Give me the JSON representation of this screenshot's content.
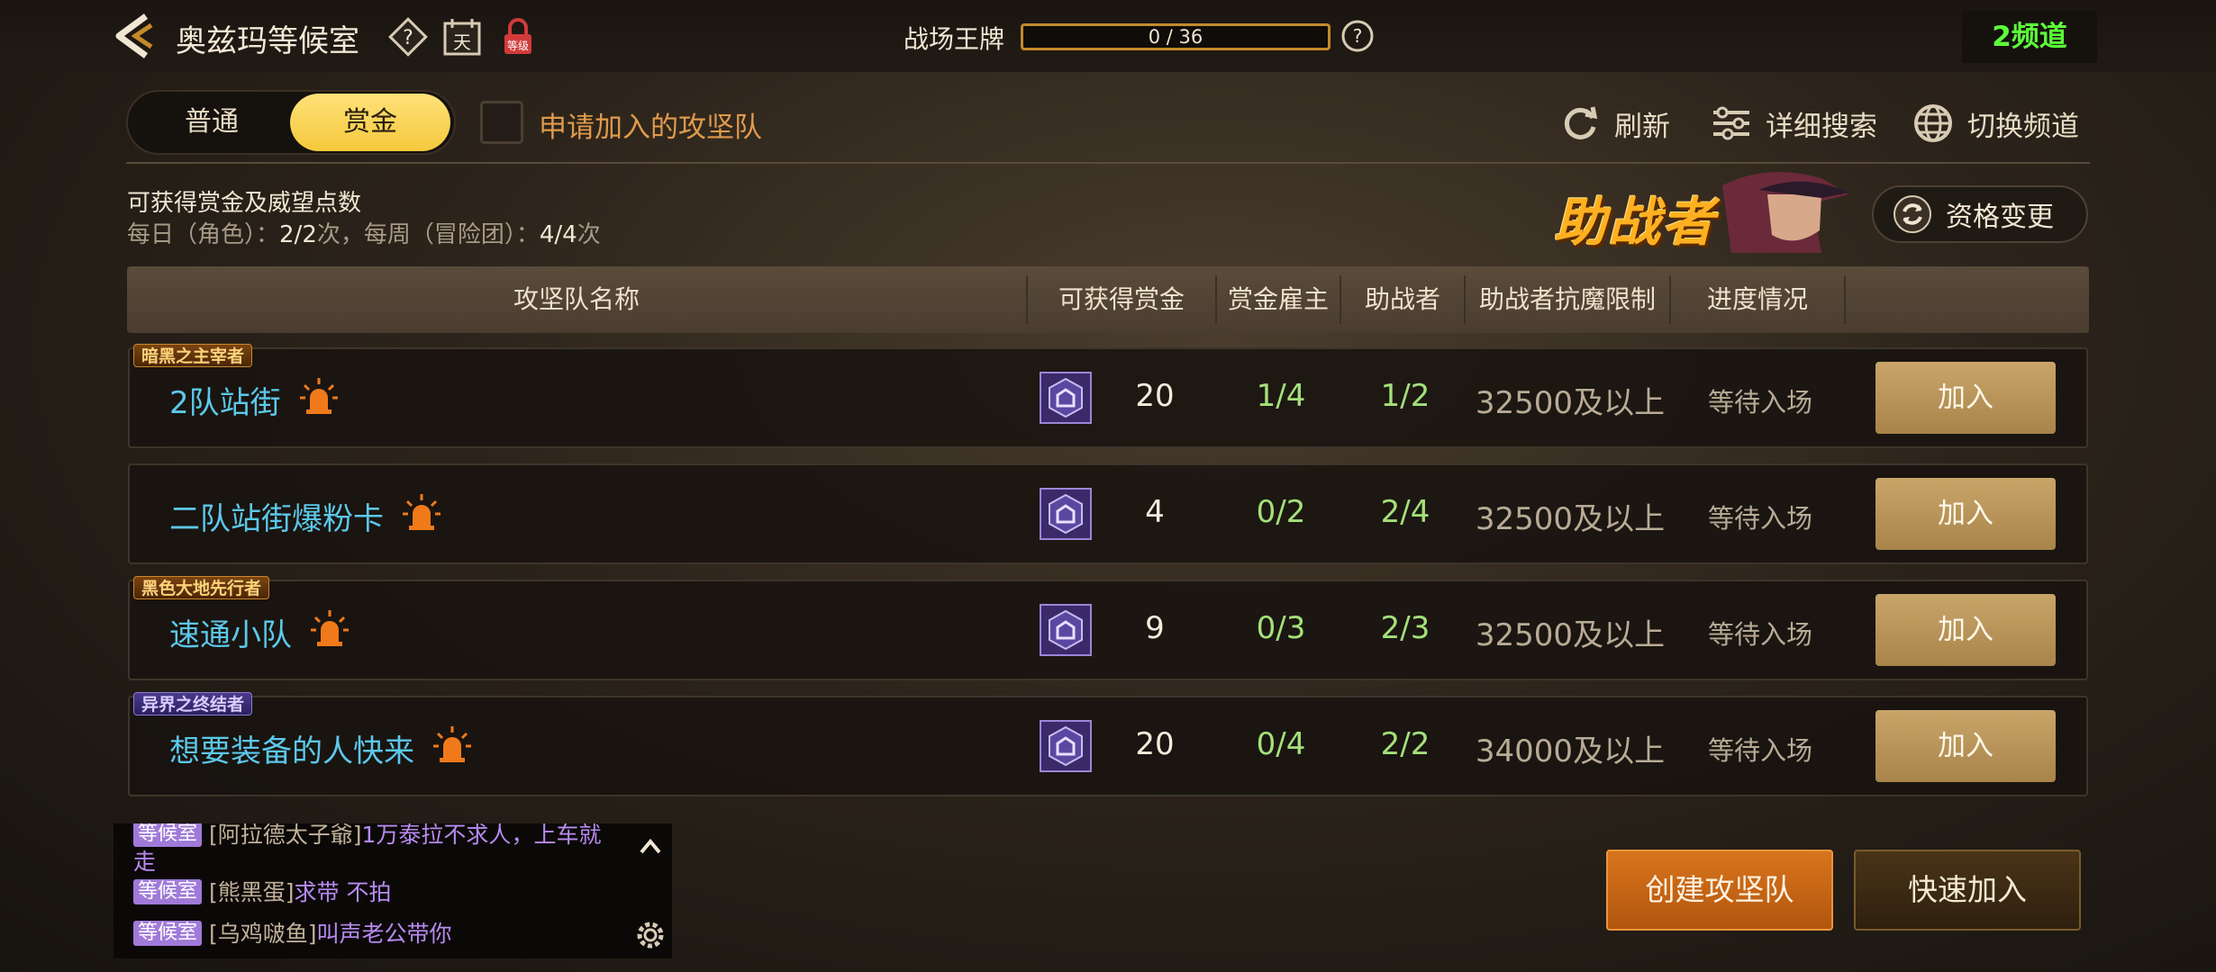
{
  "header": {
    "room_title": "奥兹玛等候室",
    "medal_title": "战场王牌",
    "medal_progress_text": "0 / 36",
    "medal_progress_fraction": 0,
    "channel": "2频道"
  },
  "tabs": [
    {
      "label": "普通",
      "active": false
    },
    {
      "label": "赏金",
      "active": true
    }
  ],
  "apply_checkbox": {
    "label": "申请加入的攻坚队",
    "checked": false
  },
  "tools": {
    "refresh": "刷新",
    "detail_search": "详细搜索",
    "switch_channel": "切换频道"
  },
  "info": {
    "title": "可获得赏金及威望点数",
    "daily_label": "每日（角色）：",
    "daily_value": "2/2",
    "daily_unit": "次，每周（冒险团）：",
    "weekly_value": "4/4",
    "weekly_unit": "次"
  },
  "helper": {
    "banner_text": "助战者",
    "change_button": "资格变更"
  },
  "table": {
    "columns": [
      "攻坚队名称",
      "可获得赏金",
      "赏金雇主",
      "助战者",
      "助战者抗魔限制",
      "进度情况"
    ],
    "rows": [
      {
        "badge": "暗黑之主宰者",
        "badge_style": "orange",
        "name": "2队站街",
        "reward": "20",
        "employer": "1/4",
        "helpers": "1/2",
        "limit": "32500及以上",
        "status": "等待入场",
        "join": "加入"
      },
      {
        "badge": "",
        "badge_style": "",
        "name": "二队站街爆粉卡",
        "reward": "4",
        "employer": "0/2",
        "helpers": "2/4",
        "limit": "32500及以上",
        "status": "等待入场",
        "join": "加入"
      },
      {
        "badge": "黑色大地先行者",
        "badge_style": "orange",
        "name": "速通小队",
        "reward": "9",
        "employer": "0/3",
        "helpers": "2/3",
        "limit": "32500及以上",
        "status": "等待入场",
        "join": "加入"
      },
      {
        "badge": "异界之终结者",
        "badge_style": "blue",
        "name": "想要装备的人快来",
        "reward": "20",
        "employer": "0/4",
        "helpers": "2/2",
        "limit": "34000及以上",
        "status": "等待入场",
        "join": "加入"
      }
    ]
  },
  "chat": [
    {
      "tag": "等候室",
      "user": "[阿拉德太子爺]",
      "msg": "1万泰拉不求人，上车就走"
    },
    {
      "tag": "等候室",
      "user": "[熊黑蛋]",
      "msg": "求带 不拍"
    },
    {
      "tag": "等候室",
      "user": "[乌鸡啵鱼]",
      "msg": "叫声老公带你"
    }
  ],
  "buttons": {
    "create": "创建攻坚队",
    "quick_join": "快速加入"
  },
  "colors": {
    "accent_gold": "#f5c83c",
    "team_name": "#5cc8ea",
    "count_green": "#a4e07a",
    "channel_green": "#5cff3a",
    "create_orange": "#d8741c"
  }
}
